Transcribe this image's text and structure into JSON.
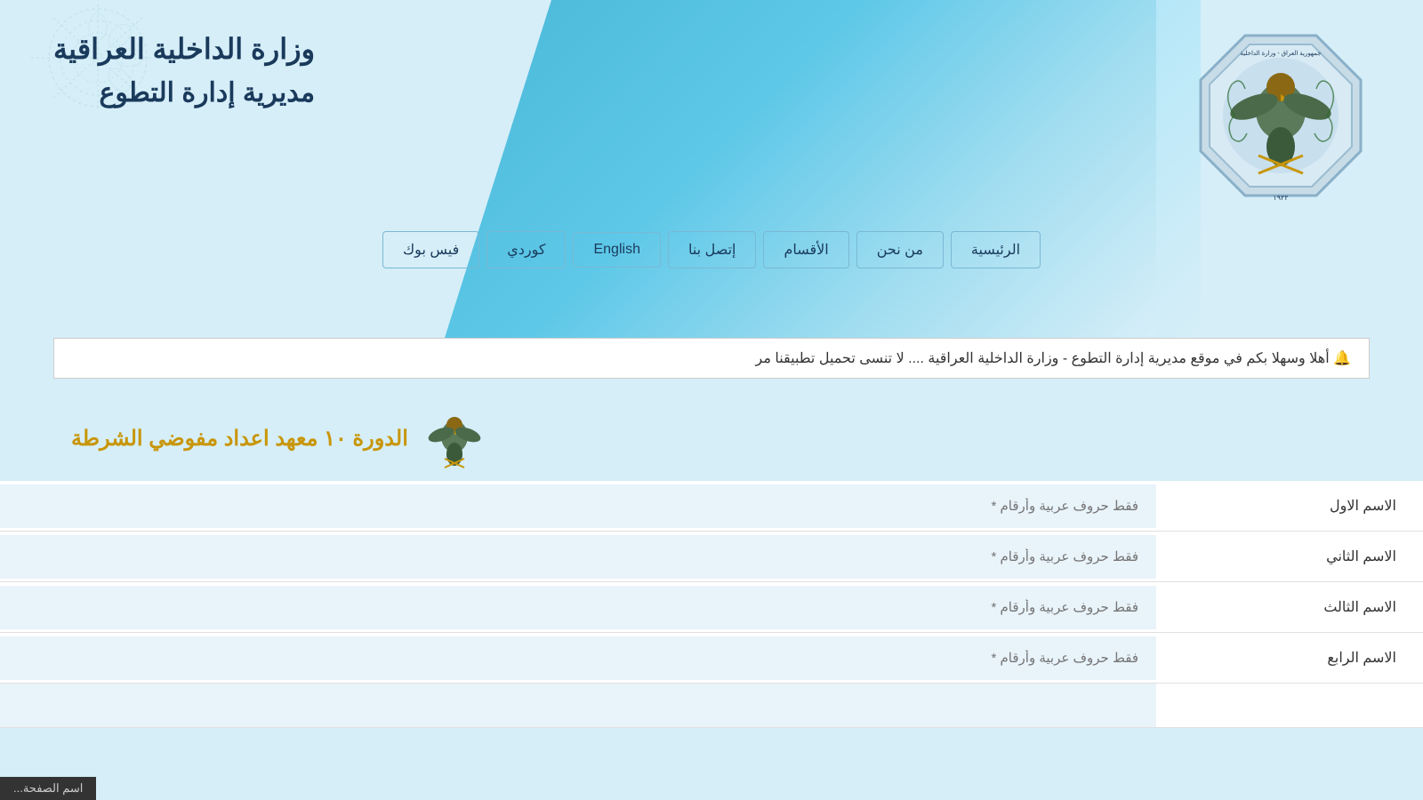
{
  "header": {
    "title_line1": "وزارة الداخلية العراقية",
    "title_line2": "مديرية إدارة التطوع"
  },
  "nav": {
    "items": [
      {
        "id": "home",
        "label": "الرئيسية"
      },
      {
        "id": "about",
        "label": "من نحن"
      },
      {
        "id": "sections",
        "label": "الأقسام"
      },
      {
        "id": "contact",
        "label": "إتصل بنا"
      },
      {
        "id": "english",
        "label": "English"
      },
      {
        "id": "kurdish",
        "label": "كوردي"
      },
      {
        "id": "facebook",
        "label": "فيس بوك"
      }
    ]
  },
  "ticker": {
    "text": "🔔 أهلا وسهلا بكم في موقع مديرية إدارة التطوع - وزارة الداخلية العراقية .... لا تنسى تحميل تطبيقنا مر"
  },
  "section": {
    "title": "الدورة ١٠ معهد اعداد مفوضي الشرطة"
  },
  "form": {
    "fields": [
      {
        "id": "first-name",
        "label": "الاسم الاول",
        "placeholder": "فقط حروف عربية وأرقام *"
      },
      {
        "id": "second-name",
        "label": "الاسم الثاني",
        "placeholder": "فقط حروف عربية وأرقام *"
      },
      {
        "id": "third-name",
        "label": "الاسم الثالث",
        "placeholder": "فقط حروف عربية وأرقام *"
      },
      {
        "id": "fourth-name",
        "label": "الاسم الرابع",
        "placeholder": "فقط حروف عربية وأرقام *"
      }
    ]
  },
  "status_bar": {
    "text": "اسم الصفحة..."
  },
  "colors": {
    "accent_blue": "#4ab8d8",
    "title_color": "#1a3a5c",
    "gold": "#c8960a",
    "light_bg": "#d6eef8",
    "input_bg": "#e8f3fa"
  }
}
